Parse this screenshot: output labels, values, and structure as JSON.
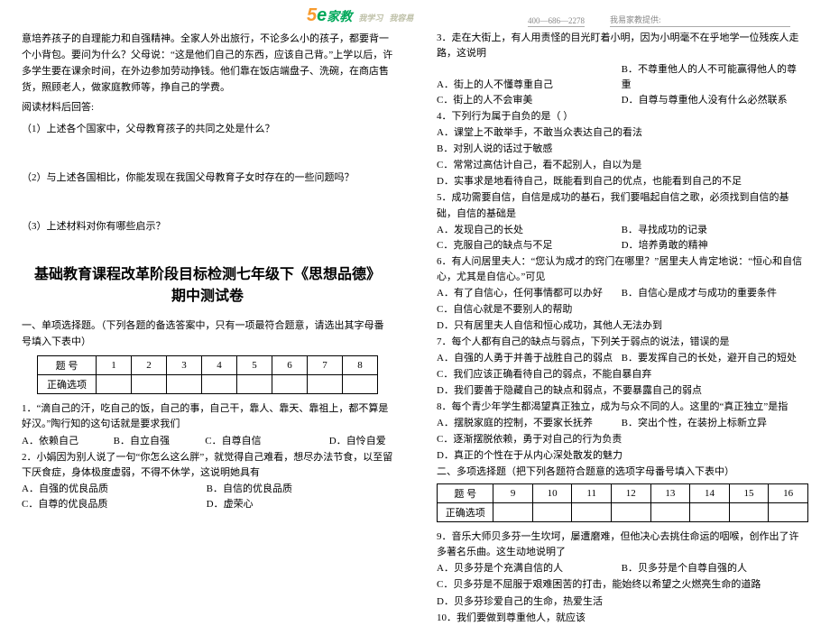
{
  "header": {
    "logo_five": "5",
    "logo_e": "e",
    "logo_hz": "家教",
    "slogan1": "我学习",
    "slogan2": "我容易",
    "phone": "400—686—2278",
    "provider": "我易家教提供:"
  },
  "left": {
    "intro": "意培养孩子的自理能力和自强精神。全家人外出旅行，不论多么小的孩子，都要背一个小背包。要问为什么？父母说：“这是他们自己的东西，应该自己背。”上学以后，许多学生要在课余时间，在外边参加劳动挣钱。他们靠在饭店端盘子、洗碗，在商店售货，照顾老人，做家庭教师等，挣自己的学费。",
    "read_prompt": "阅读材料后回答:",
    "q1": "（1）上述各个国家中，父母教育孩子的共同之处是什么？",
    "q2": "（2）与上述各国相比，你能发现在我国父母教育子女时存在的一些问题吗？",
    "q3": "（3）上述材料对你有哪些启示？",
    "title_line1": "基础教育课程改革阶段目标检测七年级下《思想品德》",
    "title_line2": "期中测试卷",
    "section1": "一、单项选择题。（下列各题的备选答案中，只有一项最符合题意，请选出其字母番号填入下表中）",
    "t1": {
      "c0": "题    号",
      "c1": "1",
      "c2": "2",
      "c3": "3",
      "c4": "4",
      "c5": "5",
      "c6": "6",
      "c7": "7",
      "c8": "8",
      "r1": "正确选项"
    },
    "q1_stem_a": "1．“滴自己的汗，吃自己的饭，自己的事，自己干，靠人、靠天、靠祖上，都不算是好汉。”陶行知的这句话就是要求我们",
    "q1_opts": {
      "a": "A．依赖自己",
      "b": "B．自立自强",
      "c": "C．自尊自信",
      "d": "D．自怜自爱"
    },
    "q2_stem": "2．小娟因为别人说了一句“你怎么这么胖”，就觉得自己难看，想尽办法节食，以至留下厌食症，身体极度虚弱，不得不休学，这说明她具有",
    "q2_opts": {
      "a": "A．自强的优良品质",
      "b": "B．自信的优良品质",
      "c": "C．自尊的优良品质",
      "d": "D．虚荣心"
    }
  },
  "right": {
    "q3_stem": "3．走在大街上，有人用责怪的目光盯着小明，因为小明毫不在乎地学一位残疾人走路，这说明",
    "q3_opts": {
      "a": "A．街上的人不懂尊重自己",
      "b": "B．不尊重他人的人不可能赢得他人的尊重",
      "c": "C．街上的人不会审美",
      "d": "D．自尊与尊重他人没有什么必然联系"
    },
    "q4_stem": "4．下列行为属于自负的是（  ）",
    "q4_opts": {
      "a": "A．课堂上不敢举手，不敢当众表达自己的看法",
      "b": "B．对别人说的话过于敏感",
      "c": "C．常常过高估计自己，看不起别人，自以为是",
      "d": "D．实事求是地看待自己，既能看到自己的优点，也能看到自己的不足"
    },
    "q5_stem": "5．成功需要自信，自信是成功的基石，我们要唱起自信之歌，必须找到自信的基础，自信的基础是",
    "q5_opts": {
      "a": "A．发现自己的长处",
      "b": "B．寻找成功的记录",
      "c": "C．克服自己的缺点与不足",
      "d": "D．培养勇敢的精神"
    },
    "q6_stem": "6．有人问居里夫人：“您认为成才的窍门在哪里？”居里夫人肯定地说：“恒心和自信心，尤其是自信心。”可见",
    "q6_opts": {
      "a": "A．有了自信心，任何事情都可以办好",
      "b": "B．自信心是成才与成功的重要条件",
      "c": "C．自信心就是不要别人的帮助",
      "d": "D．只有居里夫人自信和恒心成功，其他人无法办到"
    },
    "q7_stem": "7．每个人都有自己的缺点与弱点，下列关于弱点的说法，错误的是",
    "q7_opts": {
      "a": "A．自强的人勇于并善于战胜自己的弱点",
      "b": "B．要发挥自己的长处，避开自己的短处",
      "c": "C．我们应该正确看待自己的弱点，不能自暴自弃",
      "d": "D．我们要善于隐藏自己的缺点和弱点，不要暴露自己的弱点"
    },
    "q8_stem": "8．每个青少年学生都渴望真正独立，成为与众不同的人。这里的“真正独立”是指",
    "q8_opts": {
      "a": "A．摆脱家庭的控制，不要家长抚养",
      "b": "B．突出个性，在装扮上标新立异",
      "c": "C．逐渐摆脱依赖，勇于对自己的行为负责",
      "d": "D．真正的个性在于从内心深处散发的魅力"
    },
    "section2": "二、多项选择题（把下列各题符合题意的选项字母番号填入下表中）",
    "t2": {
      "c0": "题    号",
      "c1": "9",
      "c2": "10",
      "c3": "11",
      "c4": "12",
      "c5": "13",
      "c6": "14",
      "c7": "15",
      "c8": "16",
      "r1": "正确选项"
    },
    "q9_stem": "9．音乐大师贝多芬一生坎坷，屡遭磨难，但他决心去挑住命运的咽喉，创作出了许多著名乐曲。这生动地说明了",
    "q9_opts": {
      "a": "A．贝多芬是个充满自信的人",
      "b": "B．贝多芬是个自尊自强的人",
      "c": "C．贝多芬是不屈服于艰难困苦的打击，能始终以希望之火燃亮生命的道路",
      "d": "D．贝多芬珍爱自己的生命，热爱生活"
    },
    "q10_stem": "10．我们要做到尊重他人，就应该"
  }
}
